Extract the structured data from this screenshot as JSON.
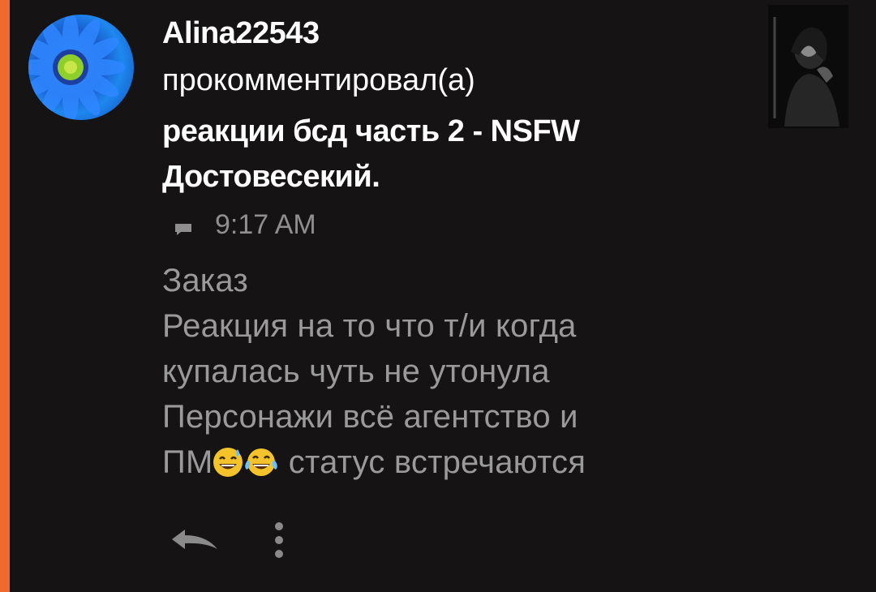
{
  "comment": {
    "username": "Alina22543",
    "action_text": "прокомментировал(а)",
    "post_title": "реакции бсд часть 2 - NSFW Достовесекий.",
    "time": "9:17 AM",
    "body_lines": [
      "Заказ",
      "Реакция на то что т/и когда",
      "купалась чуть не утонула",
      "Персонажи всё  агентство и"
    ],
    "last_line_prefix": "ПМ",
    "last_line_suffix": " статус встречаются",
    "emojis": [
      "grinning-sweat-emoji",
      "tears-of-joy-emoji"
    ]
  },
  "colors": {
    "accent": "#f06a2e",
    "background": "#151314",
    "title_text": "#ffffff",
    "body_text": "#9a9a9a",
    "meta_text": "#8f8f8f"
  },
  "icons": {
    "comment": "comment-icon",
    "reply": "reply-icon",
    "more": "more-vertical-icon"
  }
}
